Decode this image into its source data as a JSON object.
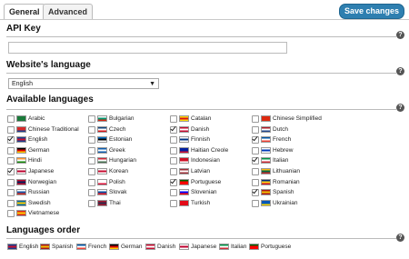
{
  "tabs": [
    {
      "label": "General"
    },
    {
      "label": "Advanced"
    }
  ],
  "toolbar": {
    "save_label": "Save changes"
  },
  "api_key": {
    "title": "API Key",
    "value": ""
  },
  "website_language": {
    "title": "Website's language",
    "selected": "English"
  },
  "available": {
    "title": "Available languages",
    "columns": [
      [
        {
          "label": "Arabic",
          "checked": false,
          "flag": [
            "#1a7a3a",
            "#1a7a3a",
            "#1a7a3a"
          ]
        },
        {
          "label": "Chinese Traditional",
          "checked": false,
          "flag": [
            "#d62a2a",
            "#d62a2a",
            "#1c3d8f"
          ]
        },
        {
          "label": "English",
          "checked": true,
          "flag": [
            "#1c3d8f",
            "#c8102e",
            "#1c3d8f"
          ]
        },
        {
          "label": "German",
          "checked": false,
          "flag": [
            "#000000",
            "#dd0000",
            "#ffce00"
          ]
        },
        {
          "label": "Hindi",
          "checked": false,
          "flag": [
            "#ff9933",
            "#ffffff",
            "#138808"
          ]
        },
        {
          "label": "Japanese",
          "checked": true,
          "flag": [
            "#ffffff",
            "#bc002d",
            "#ffffff"
          ]
        },
        {
          "label": "Norwegian",
          "checked": false,
          "flag": [
            "#ba0c2f",
            "#00205b",
            "#ba0c2f"
          ]
        },
        {
          "label": "Russian",
          "checked": false,
          "flag": [
            "#ffffff",
            "#1c57a5",
            "#d52b1e"
          ]
        },
        {
          "label": "Swedish",
          "checked": false,
          "flag": [
            "#006aa7",
            "#fecc00",
            "#006aa7"
          ]
        },
        {
          "label": "Vietnamese",
          "checked": false,
          "flag": [
            "#da251d",
            "#ffcd00",
            "#da251d"
          ]
        }
      ],
      [
        {
          "label": "Bulgarian",
          "checked": false,
          "flag": [
            "#ffffff",
            "#00966e",
            "#d62612"
          ]
        },
        {
          "label": "Czech",
          "checked": false,
          "flag": [
            "#11457e",
            "#ffffff",
            "#d7141a"
          ]
        },
        {
          "label": "Estonian",
          "checked": false,
          "flag": [
            "#0072ce",
            "#000000",
            "#ffffff"
          ]
        },
        {
          "label": "Greek",
          "checked": false,
          "flag": [
            "#0d5eaf",
            "#ffffff",
            "#0d5eaf"
          ]
        },
        {
          "label": "Hungarian",
          "checked": false,
          "flag": [
            "#ce2939",
            "#ffffff",
            "#477050"
          ]
        },
        {
          "label": "Korean",
          "checked": false,
          "flag": [
            "#ffffff",
            "#c60c30",
            "#ffffff"
          ]
        },
        {
          "label": "Polish",
          "checked": false,
          "flag": [
            "#ffffff",
            "#ffffff",
            "#dc143c"
          ]
        },
        {
          "label": "Slovak",
          "checked": false,
          "flag": [
            "#ffffff",
            "#0b4ea2",
            "#ee1c25"
          ]
        },
        {
          "label": "Thai",
          "checked": false,
          "flag": [
            "#a51931",
            "#2d2a4a",
            "#a51931"
          ]
        }
      ],
      [
        {
          "label": "Catalan",
          "checked": false,
          "flag": [
            "#fcdd09",
            "#da121a",
            "#fcdd09"
          ]
        },
        {
          "label": "Danish",
          "checked": true,
          "flag": [
            "#c60c30",
            "#ffffff",
            "#c60c30"
          ]
        },
        {
          "label": "Finnish",
          "checked": false,
          "flag": [
            "#ffffff",
            "#003580",
            "#ffffff"
          ]
        },
        {
          "label": "Haitian Creole",
          "checked": false,
          "flag": [
            "#00209f",
            "#00209f",
            "#d21034"
          ]
        },
        {
          "label": "Indonesian",
          "checked": false,
          "flag": [
            "#ce1126",
            "#ce1126",
            "#ffffff"
          ]
        },
        {
          "label": "Latvian",
          "checked": false,
          "flag": [
            "#9e3039",
            "#ffffff",
            "#9e3039"
          ]
        },
        {
          "label": "Portuguese",
          "checked": true,
          "flag": [
            "#006600",
            "#ff0000",
            "#ff0000"
          ]
        },
        {
          "label": "Slovenian",
          "checked": false,
          "flag": [
            "#ffffff",
            "#0000ff",
            "#ff0000"
          ]
        },
        {
          "label": "Turkish",
          "checked": false,
          "flag": [
            "#e30a17",
            "#e30a17",
            "#e30a17"
          ]
        }
      ],
      [
        {
          "label": "Chinese Simplified",
          "checked": false,
          "flag": [
            "#de2910",
            "#de2910",
            "#de2910"
          ]
        },
        {
          "label": "Dutch",
          "checked": false,
          "flag": [
            "#ae1c28",
            "#ffffff",
            "#21468b"
          ]
        },
        {
          "label": "French",
          "checked": true,
          "flag": [
            "#0055a4",
            "#ffffff",
            "#ef4135"
          ]
        },
        {
          "label": "Hebrew",
          "checked": false,
          "flag": [
            "#ffffff",
            "#0038b8",
            "#ffffff"
          ]
        },
        {
          "label": "Italian",
          "checked": true,
          "flag": [
            "#009246",
            "#ffffff",
            "#ce2b37"
          ]
        },
        {
          "label": "Lithuanian",
          "checked": false,
          "flag": [
            "#fdb913",
            "#006a44",
            "#c1272d"
          ]
        },
        {
          "label": "Romanian",
          "checked": false,
          "flag": [
            "#002b7f",
            "#fcd116",
            "#ce1126"
          ]
        },
        {
          "label": "Spanish",
          "checked": true,
          "flag": [
            "#aa151b",
            "#f1bf00",
            "#aa151b"
          ]
        },
        {
          "label": "Ukrainian",
          "checked": false,
          "flag": [
            "#0057b7",
            "#0057b7",
            "#ffd700"
          ]
        }
      ]
    ]
  },
  "order": {
    "title": "Languages order",
    "items": [
      {
        "label": "English",
        "flag": [
          "#1c3d8f",
          "#c8102e",
          "#1c3d8f"
        ]
      },
      {
        "label": "Spanish",
        "flag": [
          "#aa151b",
          "#f1bf00",
          "#aa151b"
        ]
      },
      {
        "label": "French",
        "flag": [
          "#0055a4",
          "#ffffff",
          "#ef4135"
        ]
      },
      {
        "label": "German",
        "flag": [
          "#000000",
          "#dd0000",
          "#ffce00"
        ]
      },
      {
        "label": "Danish",
        "flag": [
          "#c60c30",
          "#ffffff",
          "#c60c30"
        ]
      },
      {
        "label": "Japanese",
        "flag": [
          "#ffffff",
          "#bc002d",
          "#ffffff"
        ]
      },
      {
        "label": "Italian",
        "flag": [
          "#009246",
          "#ffffff",
          "#ce2b37"
        ]
      },
      {
        "label": "Portuguese",
        "flag": [
          "#006600",
          "#ff0000",
          "#ff0000"
        ]
      }
    ]
  }
}
